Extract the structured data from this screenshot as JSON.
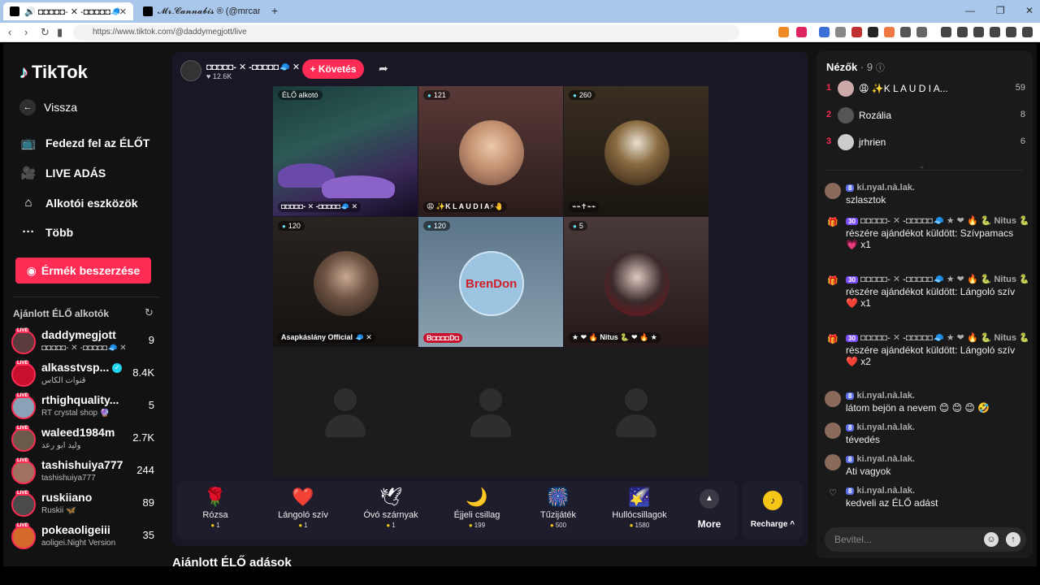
{
  "browser": {
    "tabs": [
      {
        "label": "🔊 ◘◘◘◘◘- ✕ -◘◘◘◘◘🧢 (@da"
      },
      {
        "label": "𝓜𝓻.𝓒𝓪𝓷𝓷𝓪𝓫𝓲𝓼 ® (@mrcannabis_"
      }
    ],
    "new_tab": "+",
    "url": "https://www.tiktok.com/@daddymegjott/live"
  },
  "sidebar": {
    "logo": "TikTok",
    "back": "Vissza",
    "nav": [
      {
        "label": "Fedezd fel az ÉLŐT",
        "icon": "live-tv-icon"
      },
      {
        "label": "LIVE ADÁS",
        "icon": "camera-icon"
      },
      {
        "label": "Alkotói eszközök",
        "icon": "creator-tools-icon"
      },
      {
        "label": "Több",
        "icon": "more-dots-icon"
      }
    ],
    "coins_button": "Érmék beszerzése",
    "recommended_title": "Ajánlott ÉLŐ alkotók",
    "live_tag": "LIVE",
    "creators": [
      {
        "name": "daddymegjott",
        "sub": "◘◘◘◘◘- ✕ -◘◘◘◘◘🧢 ✕",
        "count": "9",
        "color": "#5a3b3b"
      },
      {
        "name": "alkasstvsp...",
        "sub": "قنوات الكأس",
        "count": "8.4K",
        "color": "#c8102e",
        "verified": "✓"
      },
      {
        "name": "rthighquality...",
        "sub": "RT crystal shop 🔮",
        "count": "5",
        "color": "#8aa2b8"
      },
      {
        "name": "waleed1984m",
        "sub": "وليد ابو رعد",
        "count": "2.7K",
        "color": "#6b5a4a"
      },
      {
        "name": "tashishuiya777",
        "sub": "tashishuiya777",
        "count": "244",
        "color": "#a07060"
      },
      {
        "name": "ruskiiano",
        "sub": "Ruskii 🦋",
        "count": "89",
        "color": "#4a4a4a"
      },
      {
        "name": "pokeaoligeiii",
        "sub": "aoligei.Night Version",
        "count": "35",
        "color": "#d46a2a"
      }
    ]
  },
  "stream": {
    "host_name": "◘◘◘◘◘- ✕ -◘◘◘◘◘🧢 ✕",
    "host_likes": "♥ 12.6K",
    "follow": "+ Követés",
    "cells": [
      {
        "badge": "ÉLŐ alkotó",
        "name": "◘◘◘◘◘- ✕ -◘◘◘◘◘🧢 ✕"
      },
      {
        "badge": "121",
        "name": "😩 ✨K L A U D I A⚡🤚"
      },
      {
        "badge": "260",
        "name": "⌁⌁✝⌁⌁"
      },
      {
        "badge": "120",
        "name": "Asapkáslány Official 🧢 ✕"
      },
      {
        "badge": "120",
        "name": "B◘◘◘◘D◘"
      },
      {
        "badge": "5",
        "name": "★ ❤ 🔥 Nitus 🐍 ❤ 🔥 ★"
      }
    ],
    "brendon_text": "BrenDon"
  },
  "gifts": [
    {
      "name": "Rózsa",
      "price": "1",
      "icon": "🌹"
    },
    {
      "name": "Lángoló szív",
      "price": "1",
      "icon": "❤️"
    },
    {
      "name": "Óvó szárnyak",
      "price": "1",
      "icon": "🕊"
    },
    {
      "name": "Éjjeli csillag",
      "price": "199",
      "icon": "🌙"
    },
    {
      "name": "Tűzijáték",
      "price": "500",
      "icon": "🎆"
    },
    {
      "name": "Hullócsillagok",
      "price": "1580",
      "icon": "🌠"
    }
  ],
  "more_label": "More",
  "recharge_label": "Recharge ^",
  "below_title": "Ajánlott ÉLŐ adások",
  "viewers": {
    "title": "Nézők",
    "count": "· 9",
    "list": [
      {
        "rank": "1",
        "name": "😩 ✨K L A U D I A...",
        "score": "59",
        "color": "#caa"
      },
      {
        "rank": "2",
        "name": "Rozália",
        "score": "8",
        "color": "#555"
      },
      {
        "rank": "3",
        "name": "jrhrien",
        "score": "6",
        "color": "#ccc"
      }
    ]
  },
  "chat": [
    {
      "user": "ki.nyal.nà.lak.",
      "level": "8",
      "text": "szlasztok"
    },
    {
      "user": "◘◘◘◘◘- ✕ -◘◘◘◘◘🧢 ★ ❤ 🔥 🐍 Nitus 🐍 ...",
      "level": "30",
      "text": "részére ajándékot küldött: Szívpamacs 💗 x1",
      "gift": true
    },
    {
      "user": "◘◘◘◘◘- ✕ -◘◘◘◘◘🧢 ★ ❤ 🔥 🐍 Nitus 🐍 ...",
      "level": "30",
      "text": "részére ajándékot küldött: Lángoló szív ❤️ x1",
      "gift": true
    },
    {
      "user": "◘◘◘◘◘- ✕ -◘◘◘◘◘🧢 ★ ❤ 🔥 🐍 Nitus 🐍 ...",
      "level": "30",
      "text": "részére ajándékot küldött: Lángoló szív ❤️ x2",
      "gift": true
    },
    {
      "user": "ki.nyal.nà.lak.",
      "level": "8",
      "text": "látom bejön a nevem 😊 😊 😊 🤣"
    },
    {
      "user": "ki.nyal.nà.lak.",
      "level": "8",
      "text": "tévedés"
    },
    {
      "user": "ki.nyal.nà.lak.",
      "level": "8",
      "text": "Ati vagyok"
    },
    {
      "user": "ki.nyal.nà.lak.",
      "level": "8",
      "text": "kedveli az ÉLŐ adást",
      "like": true
    }
  ],
  "input_placeholder": "Bevitel..."
}
